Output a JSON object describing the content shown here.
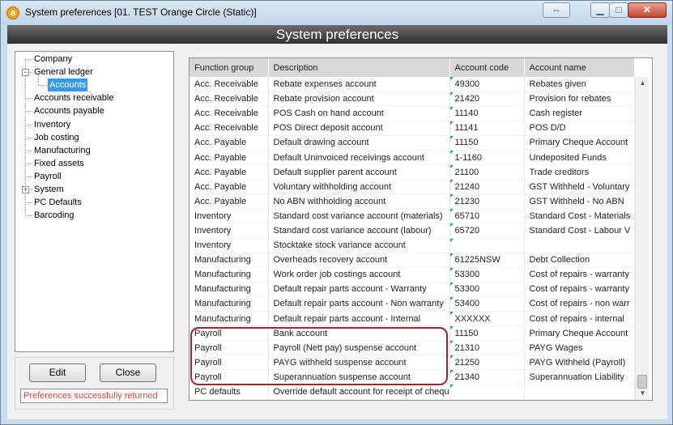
{
  "window": {
    "title": "System preferences [01. TEST Orange Circle (Static)]",
    "app_icon_glyph": "a",
    "header": "System preferences"
  },
  "tree": {
    "items": [
      {
        "label": "Company"
      },
      {
        "label": "General ledger",
        "expander": "−"
      },
      {
        "label": "Accounts",
        "selected": true
      },
      {
        "label": "Accounts receivable"
      },
      {
        "label": "Accounts payable"
      },
      {
        "label": "Inventory"
      },
      {
        "label": "Job costing"
      },
      {
        "label": "Manufacturing"
      },
      {
        "label": "Fixed assets"
      },
      {
        "label": "Payroll"
      },
      {
        "label": "System",
        "expander": "+"
      },
      {
        "label": "PC Defaults"
      },
      {
        "label": "Barcoding"
      }
    ]
  },
  "buttons": {
    "edit": "Edit",
    "close": "Close"
  },
  "status": {
    "text": "Preferences successfully returned",
    "color": "#e04040"
  },
  "grid": {
    "columns": [
      "Function group",
      "Description",
      "Account code",
      "Account name"
    ],
    "rows": [
      [
        "Acc. Receivable",
        "Rebate expenses account",
        "49300",
        "Rebates given"
      ],
      [
        "Acc. Receivable",
        "Rebate provision account",
        "21420",
        "Provision for rebates"
      ],
      [
        "Acc. Receivable",
        "POS Cash on hand account",
        "11140",
        "Cash register"
      ],
      [
        "Acc. Receivable",
        "POS Direct deposit account",
        "11141",
        "POS D/D"
      ],
      [
        "Acc. Payable",
        "Default drawing account",
        "11150",
        "Primary Cheque Account"
      ],
      [
        "Acc. Payable",
        "Default Uninvoiced receivings account",
        "1-1160",
        "Undeposited Funds"
      ],
      [
        "Acc. Payable",
        "Default supplier parent account",
        "21100",
        "Trade creditors"
      ],
      [
        "Acc. Payable",
        "Voluntary withholding account",
        "21240",
        "GST Withheld - Voluntary"
      ],
      [
        "Acc. Payable",
        "No ABN withholding account",
        "21230",
        "GST Withheld - No ABN"
      ],
      [
        "Inventory",
        "Standard cost variance account (materials)",
        "65710",
        "Standard Cost - Materials"
      ],
      [
        "Inventory",
        "Standard cost variance account (labour)",
        "65720",
        "Standard Cost - Labour V"
      ],
      [
        "Inventory",
        "Stocktake stock variance account",
        "",
        ""
      ],
      [
        "Manufacturing",
        "Overheads recovery account",
        "61225NSW",
        "Debt Collection"
      ],
      [
        "Manufacturing",
        "Work order job costings account",
        "53300",
        "Cost of repairs - warranty"
      ],
      [
        "Manufacturing",
        "Default repair parts account - Warranty",
        "53300",
        "Cost of repairs - warranty"
      ],
      [
        "Manufacturing",
        "Default repair parts account - Non warranty",
        "53400",
        "Cost of repairs - non warr"
      ],
      [
        "Manufacturing",
        "Default repair parts account - Internal",
        "XXXXXX",
        "Cost of repairs - internal"
      ],
      [
        "Payroll",
        "Bank account",
        "11150",
        "Primary Cheque Account"
      ],
      [
        "Payroll",
        "Payroll (Nett pay) suspense account",
        "21310",
        "PAYG Wages"
      ],
      [
        "Payroll",
        "PAYG withheld suspense account",
        "21250",
        "PAYG Withheld (Payroll)"
      ],
      [
        "Payroll",
        "Superannuation suspense account",
        "21340",
        "Superannuation Liability"
      ],
      [
        "PC defaults",
        "Override default account for receipt of chequ",
        "",
        ""
      ]
    ]
  },
  "scroll": {
    "position_fraction": 0.95
  }
}
